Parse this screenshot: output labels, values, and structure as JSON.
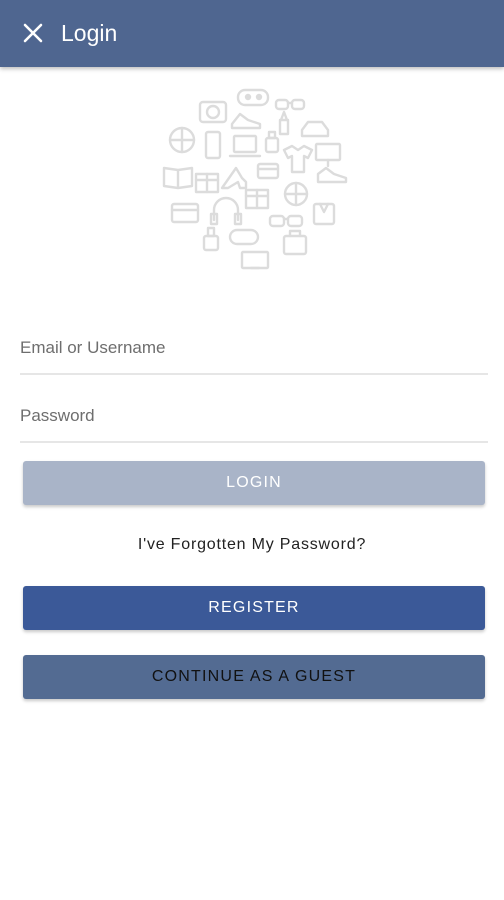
{
  "appbar": {
    "title": "Login",
    "close_icon": "close-icon",
    "background": "#4f6690"
  },
  "hero": {
    "icon": "shopping-icons-collage"
  },
  "form": {
    "email_placeholder": "Email or Username",
    "email_value": "",
    "password_placeholder": "Password",
    "password_value": ""
  },
  "actions": {
    "login_label": "LOGIN",
    "forgot_label": "I've Forgotten My Password?",
    "register_label": "REGISTER",
    "guest_label": "CONTINUE AS A GUEST"
  },
  "colors": {
    "login_disabled": "#a9b4c8",
    "register": "#3b5998",
    "guest": "#536b92"
  }
}
